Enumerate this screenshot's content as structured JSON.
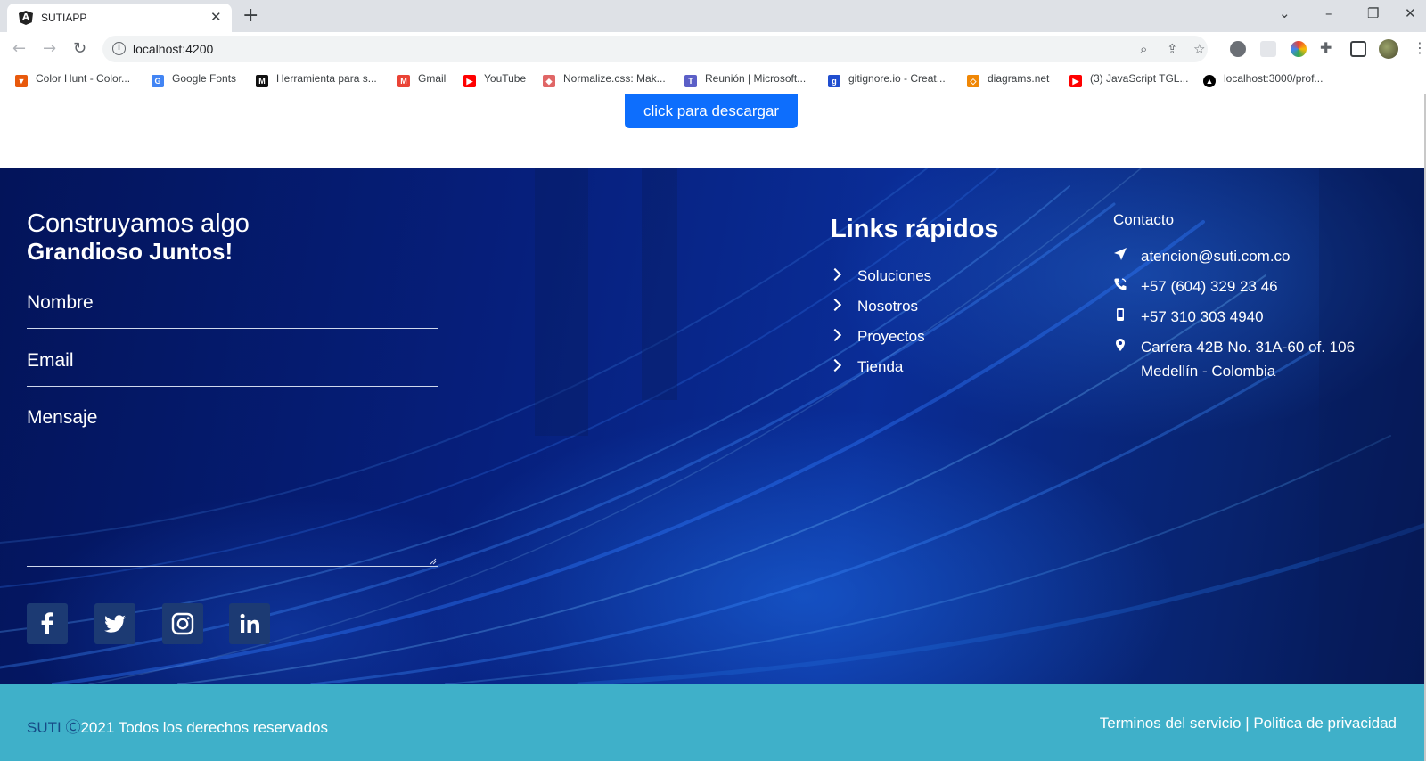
{
  "browser": {
    "tab_title": "SUTIAPP",
    "url": "localhost:4200",
    "bookmarks": [
      {
        "label": "Color Hunt - Color...",
        "icon": "color-hunt-icon",
        "color": "#e8590c"
      },
      {
        "label": "Google Fonts",
        "icon": "google-fonts-icon",
        "color": "#4285f4"
      },
      {
        "label": "Herramienta para s...",
        "icon": "m-logo-icon",
        "color": "#111111"
      },
      {
        "label": "Gmail",
        "icon": "gmail-icon",
        "color": "#ea4335"
      },
      {
        "label": "YouTube",
        "icon": "youtube-icon",
        "color": "#ff0000"
      },
      {
        "label": "Normalize.css: Mak...",
        "icon": "normalize-icon",
        "color": "#e06666"
      },
      {
        "label": "Reunión | Microsoft...",
        "icon": "teams-icon",
        "color": "#5b5fc7"
      },
      {
        "label": "gitignore.io - Creat...",
        "icon": "gitignore-icon",
        "color": "#204ecf"
      },
      {
        "label": "diagrams.net",
        "icon": "diagrams-icon",
        "color": "#f08705"
      },
      {
        "label": "(3) JavaScript TGL...",
        "icon": "youtube-icon",
        "color": "#ff0000"
      },
      {
        "label": "localhost:3000/prof...",
        "icon": "triangle-icon",
        "color": "#000000"
      }
    ]
  },
  "page": {
    "download_label": "click para descargar"
  },
  "contact_form": {
    "heading_line1": "Construyamos algo",
    "heading_line2": "Grandioso Juntos!",
    "name_label": "Nombre",
    "email_label": "Email",
    "message_label": "Mensaje"
  },
  "social": [
    {
      "icon": "facebook-icon",
      "glyph": "f"
    },
    {
      "icon": "twitter-icon",
      "glyph": ""
    },
    {
      "icon": "instagram-icon",
      "glyph": ""
    },
    {
      "icon": "linkedin-icon",
      "glyph": "in"
    }
  ],
  "quick_links": {
    "title": "Links rápidos",
    "items": [
      "Soluciones",
      "Nosotros",
      "Proyectos",
      "Tienda"
    ]
  },
  "contact": {
    "title": "Contacto",
    "email": "atencion@suti.com.co",
    "phone": "+57 (604) 329 23 46",
    "mobile": "+57 310 303 4940",
    "address_line1": "Carrera 42B No. 31A-60 of. 106",
    "address_line2": "Medellín - Colombia"
  },
  "bottom": {
    "brand": "SUTI",
    "copyright_symbol": "Ⓒ",
    "rights": "2021 Todos los derechos reservados",
    "legal": "Terminos del servicio | Politica de privacidad"
  },
  "colors": {
    "accent": "#0d6efd",
    "footer_bar": "#3fb0c9",
    "brand_text": "#164a86"
  }
}
